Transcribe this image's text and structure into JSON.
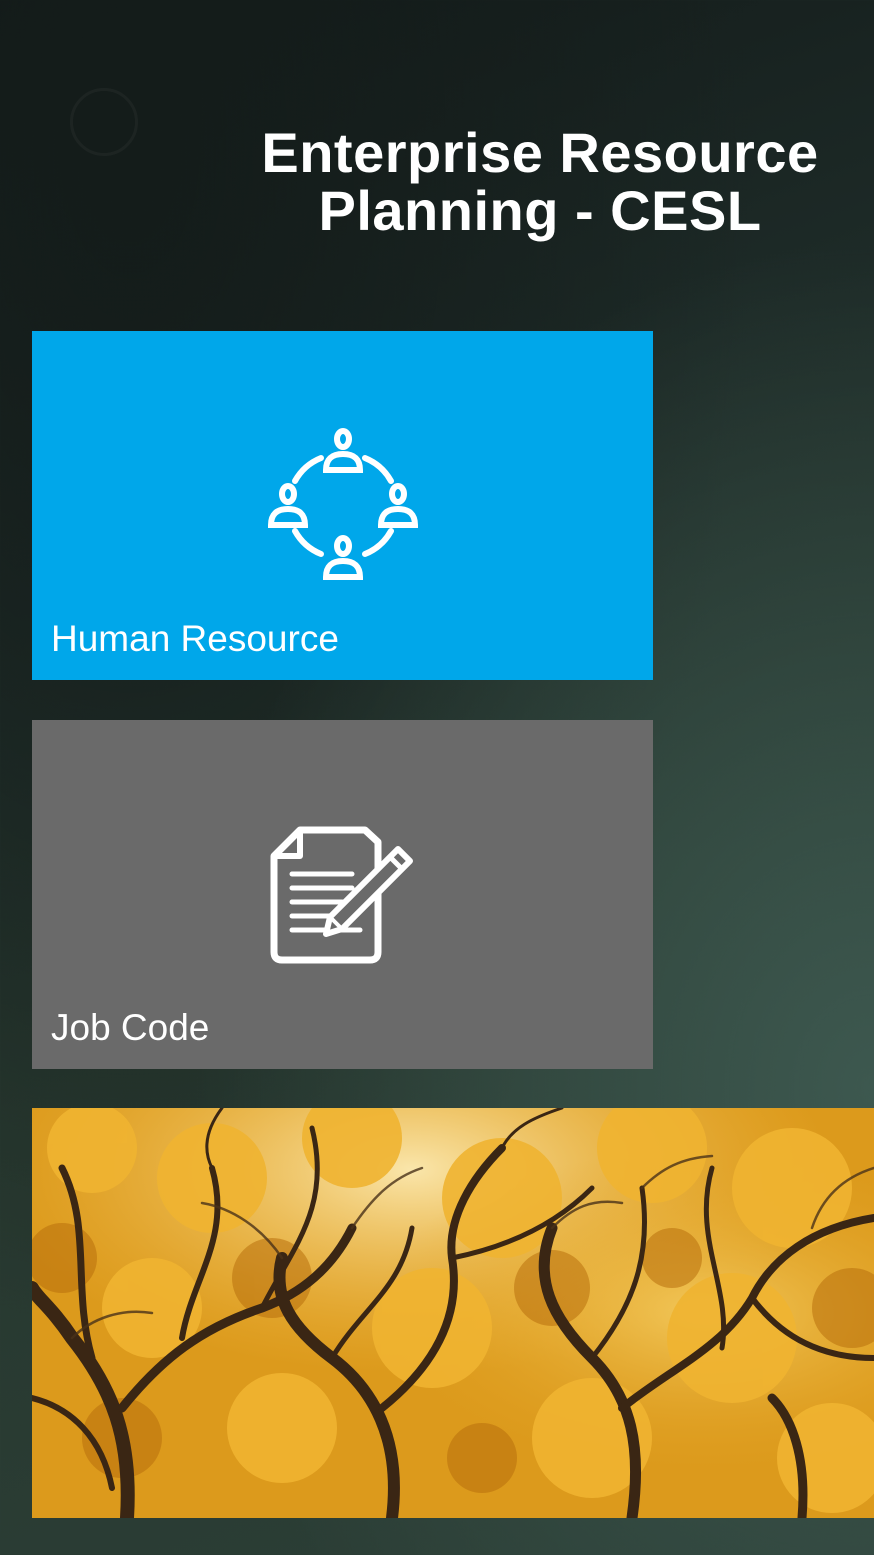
{
  "header": {
    "title_line1": "Enterprise Resource",
    "title_line2": "Planning - CESL"
  },
  "tiles": [
    {
      "label": "Human Resource",
      "icon": "team-network-icon",
      "color": "#00a7ea"
    },
    {
      "label": "Job Code",
      "icon": "document-edit-icon",
      "color": "#6a6a6a"
    }
  ],
  "photo_tile": {
    "image": "autumn-trees-photo"
  },
  "colors": {
    "background": "#1d2a27",
    "hr_tile": "#00a7ea",
    "job_tile": "#6a6a6a",
    "text": "#ffffff"
  }
}
